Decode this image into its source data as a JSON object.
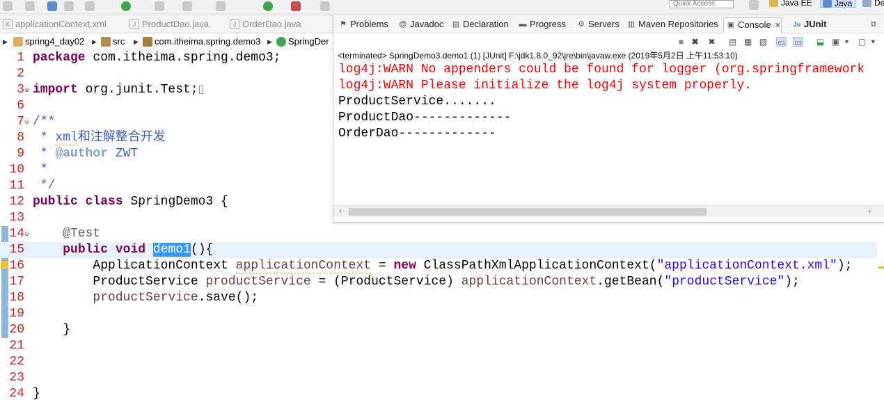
{
  "toolbar": {
    "quick_access_placeholder": "Quick Access",
    "perspectives": [
      {
        "label": "Java EE"
      },
      {
        "label": "Java"
      },
      {
        "label": "De"
      }
    ]
  },
  "editor_tabs": [
    {
      "label": "applicationContext.xml",
      "icon": "xml-file-icon"
    },
    {
      "label": "ProductDao.java",
      "icon": "java-file-icon"
    },
    {
      "label": "OrderDao.java",
      "icon": "java-file-icon"
    }
  ],
  "breadcrumb": [
    {
      "label": "spring4_day02",
      "icon": "project-icon"
    },
    {
      "label": "src",
      "icon": "package-folder-icon"
    },
    {
      "label": "com.itheima.spring.demo3",
      "icon": "package-icon"
    },
    {
      "label": "SpringDer",
      "icon": "class-icon"
    }
  ],
  "code": {
    "lines": [
      {
        "n": "1",
        "fold": "",
        "parts": [
          {
            "t": "package",
            "c": "kw"
          },
          {
            "t": " com.itheima.spring.demo3;",
            "c": ""
          }
        ]
      },
      {
        "n": "2",
        "fold": "",
        "parts": []
      },
      {
        "n": "3",
        "fold": "⊕",
        "parts": [
          {
            "t": "import",
            "c": "kw"
          },
          {
            "t": " org.junit.Test;",
            "c": ""
          },
          {
            "t": "▯",
            "c": ""
          }
        ]
      },
      {
        "n": "6",
        "fold": "",
        "parts": []
      },
      {
        "n": "7",
        "fold": "⊖",
        "parts": [
          {
            "t": "/**",
            "c": "cm"
          }
        ]
      },
      {
        "n": "8",
        "fold": "",
        "parts": [
          {
            "t": " * ",
            "c": "cm"
          },
          {
            "t": "xml",
            "c": "cm squig"
          },
          {
            "t": "和注解整合开发",
            "c": "cm"
          }
        ]
      },
      {
        "n": "9",
        "fold": "",
        "parts": [
          {
            "t": " * ",
            "c": "cm"
          },
          {
            "t": "@author",
            "c": "jdt"
          },
          {
            "t": " ZWT",
            "c": "cm"
          }
        ]
      },
      {
        "n": "10",
        "fold": "",
        "parts": [
          {
            "t": " *",
            "c": "cm"
          }
        ]
      },
      {
        "n": "11",
        "fold": "",
        "parts": [
          {
            "t": " */",
            "c": "cm"
          }
        ]
      },
      {
        "n": "12",
        "fold": "",
        "parts": [
          {
            "t": "public",
            "c": "kw"
          },
          {
            "t": " ",
            "c": ""
          },
          {
            "t": "class",
            "c": "kw"
          },
          {
            "t": " SpringDemo3 {",
            "c": ""
          }
        ]
      },
      {
        "n": "13",
        "fold": "",
        "parts": []
      },
      {
        "n": "14",
        "fold": "⊖",
        "parts": [
          {
            "t": "    @Test",
            "c": "ann"
          }
        ]
      },
      {
        "n": "15",
        "fold": "",
        "parts": [
          {
            "t": "    ",
            "c": ""
          },
          {
            "t": "public",
            "c": "kw"
          },
          {
            "t": " ",
            "c": ""
          },
          {
            "t": "void",
            "c": "kw"
          },
          {
            "t": " ",
            "c": ""
          },
          {
            "t": "demo1",
            "c": "sel"
          },
          {
            "t": "(){",
            "c": ""
          }
        ]
      },
      {
        "n": "16",
        "fold": "",
        "parts": [
          {
            "t": "        ApplicationContext ",
            "c": ""
          },
          {
            "t": "applicationContext",
            "c": "fld squig"
          },
          {
            "t": " = ",
            "c": ""
          },
          {
            "t": "new",
            "c": "kw"
          },
          {
            "t": " ClassPathXmlApplicationContext(",
            "c": ""
          },
          {
            "t": "\"applicationContext.xml\"",
            "c": "str"
          },
          {
            "t": ");",
            "c": ""
          }
        ]
      },
      {
        "n": "17",
        "fold": "",
        "parts": [
          {
            "t": "        ProductService ",
            "c": ""
          },
          {
            "t": "productService",
            "c": "fld"
          },
          {
            "t": " = (ProductService) ",
            "c": ""
          },
          {
            "t": "applicationContext",
            "c": "fld"
          },
          {
            "t": ".getBean(",
            "c": ""
          },
          {
            "t": "\"productService\"",
            "c": "str"
          },
          {
            "t": ");",
            "c": ""
          }
        ]
      },
      {
        "n": "18",
        "fold": "",
        "parts": [
          {
            "t": "        ",
            "c": ""
          },
          {
            "t": "productService",
            "c": "fld"
          },
          {
            "t": ".save();",
            "c": ""
          }
        ]
      },
      {
        "n": "19",
        "fold": "",
        "parts": []
      },
      {
        "n": "20",
        "fold": "",
        "parts": [
          {
            "t": "    }",
            "c": ""
          }
        ]
      },
      {
        "n": "21",
        "fold": "",
        "parts": []
      },
      {
        "n": "22",
        "fold": "",
        "parts": []
      },
      {
        "n": "23",
        "fold": "",
        "parts": []
      },
      {
        "n": "24",
        "fold": "",
        "parts": [
          {
            "t": "}",
            "c": ""
          }
        ]
      }
    ]
  },
  "console": {
    "tabs": [
      {
        "label": "Problems",
        "icon": "problems-icon",
        "glyph": "⚑"
      },
      {
        "label": "Javadoc",
        "icon": "javadoc-icon",
        "glyph": "@"
      },
      {
        "label": "Declaration",
        "icon": "declaration-icon",
        "glyph": "▤"
      },
      {
        "label": "Progress",
        "icon": "progress-icon",
        "glyph": "▬"
      },
      {
        "label": "Servers",
        "icon": "servers-icon",
        "glyph": "⚙"
      },
      {
        "label": "Maven Repositories",
        "icon": "maven-repositories-icon",
        "glyph": "▥"
      },
      {
        "label": "Console",
        "icon": "console-icon",
        "glyph": "▣",
        "close": "✕"
      },
      {
        "label": "JUnit",
        "icon": "junit-icon",
        "glyph": "Ju"
      }
    ],
    "terminated_line": "<terminated> SpringDemo3.demo1 (1) [JUnit] F:\\jdk1.8.0_92\\jre\\bin\\javaw.exe (2019年5月2日 上午11:53:10)",
    "lines": [
      {
        "text": "log4j:WARN No appenders could be found for logger (org.springframework",
        "kind": "err"
      },
      {
        "text": "log4j:WARN Please initialize the log4j system properly.",
        "kind": "err"
      },
      {
        "text": "ProductService.......",
        "kind": "out"
      },
      {
        "text": "ProductDao-------------",
        "kind": "out"
      },
      {
        "text": "OrderDao-------------",
        "kind": "out"
      }
    ]
  }
}
